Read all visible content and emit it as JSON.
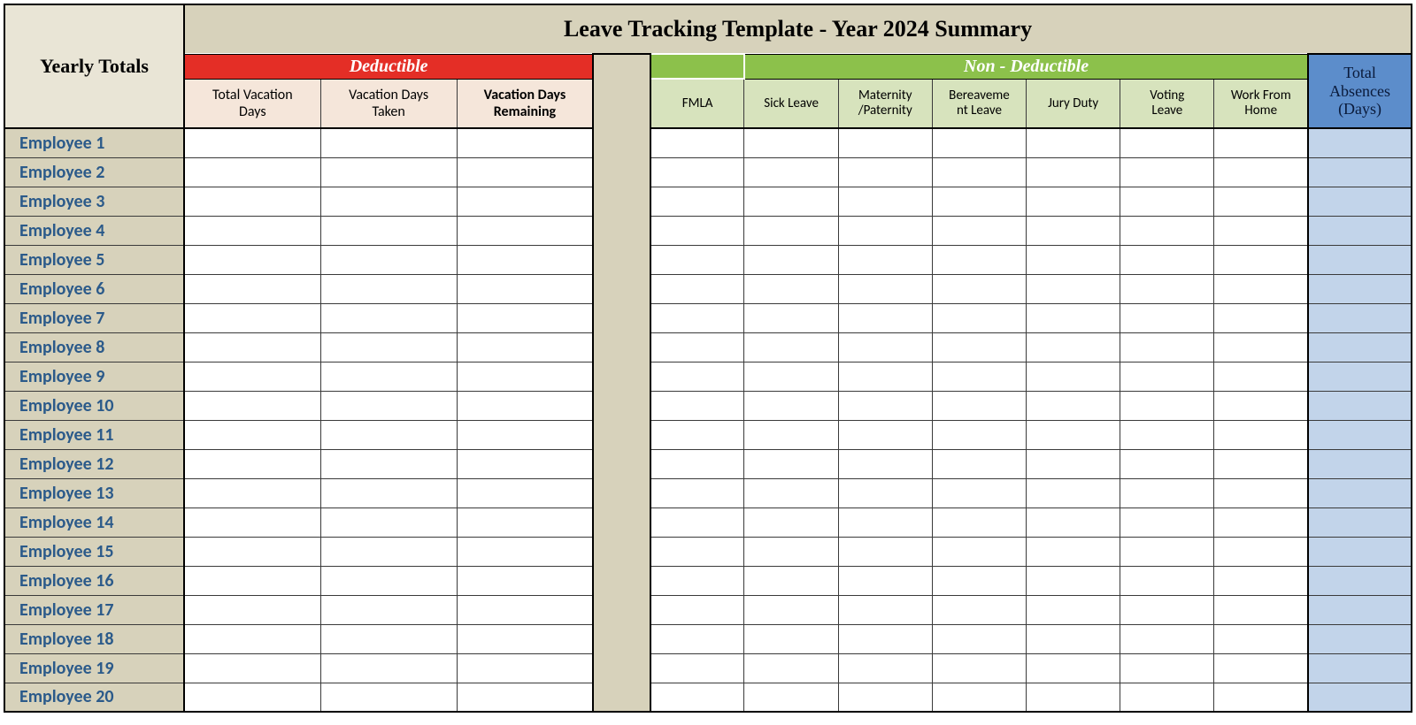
{
  "header": {
    "title": "Leave Tracking Template - Year 2024 Summary",
    "yearly_totals": "Yearly Totals",
    "deductible": "Deductible",
    "non_deductible": "Non - Deductible",
    "total_absences_l1": "Total",
    "total_absences_l2": "Absences",
    "total_absences_l3": "(Days)"
  },
  "ded_cols": {
    "c0_l1": "Total Vacation",
    "c0_l2": "Days",
    "c1_l1": "Vacation Days",
    "c1_l2": "Taken",
    "c2_l1": "Vacation Days",
    "c2_l2": "Remaining"
  },
  "nonded_cols": {
    "c0": "FMLA",
    "c1": "Sick Leave",
    "c2_l1": "Maternity",
    "c2_l2": "/Paternity",
    "c3_l1": "Bereaveme",
    "c3_l2": "nt Leave",
    "c4": "Jury Duty",
    "c5_l1": "Voting",
    "c5_l2": "Leave",
    "c6_l1": "Work From",
    "c6_l2": "Home"
  },
  "employees": [
    {
      "name": "Employee 1",
      "d0": "",
      "d1": "",
      "d2": "",
      "n0": "",
      "n1": "",
      "n2": "",
      "n3": "",
      "n4": "",
      "n5": "",
      "n6": "",
      "total": ""
    },
    {
      "name": "Employee 2",
      "d0": "",
      "d1": "",
      "d2": "",
      "n0": "",
      "n1": "",
      "n2": "",
      "n3": "",
      "n4": "",
      "n5": "",
      "n6": "",
      "total": ""
    },
    {
      "name": "Employee 3",
      "d0": "",
      "d1": "",
      "d2": "",
      "n0": "",
      "n1": "",
      "n2": "",
      "n3": "",
      "n4": "",
      "n5": "",
      "n6": "",
      "total": ""
    },
    {
      "name": "Employee 4",
      "d0": "",
      "d1": "",
      "d2": "",
      "n0": "",
      "n1": "",
      "n2": "",
      "n3": "",
      "n4": "",
      "n5": "",
      "n6": "",
      "total": ""
    },
    {
      "name": "Employee 5",
      "d0": "",
      "d1": "",
      "d2": "",
      "n0": "",
      "n1": "",
      "n2": "",
      "n3": "",
      "n4": "",
      "n5": "",
      "n6": "",
      "total": ""
    },
    {
      "name": "Employee 6",
      "d0": "",
      "d1": "",
      "d2": "",
      "n0": "",
      "n1": "",
      "n2": "",
      "n3": "",
      "n4": "",
      "n5": "",
      "n6": "",
      "total": ""
    },
    {
      "name": "Employee 7",
      "d0": "",
      "d1": "",
      "d2": "",
      "n0": "",
      "n1": "",
      "n2": "",
      "n3": "",
      "n4": "",
      "n5": "",
      "n6": "",
      "total": ""
    },
    {
      "name": "Employee 8",
      "d0": "",
      "d1": "",
      "d2": "",
      "n0": "",
      "n1": "",
      "n2": "",
      "n3": "",
      "n4": "",
      "n5": "",
      "n6": "",
      "total": ""
    },
    {
      "name": "Employee 9",
      "d0": "",
      "d1": "",
      "d2": "",
      "n0": "",
      "n1": "",
      "n2": "",
      "n3": "",
      "n4": "",
      "n5": "",
      "n6": "",
      "total": ""
    },
    {
      "name": "Employee 10",
      "d0": "",
      "d1": "",
      "d2": "",
      "n0": "",
      "n1": "",
      "n2": "",
      "n3": "",
      "n4": "",
      "n5": "",
      "n6": "",
      "total": ""
    },
    {
      "name": "Employee 11",
      "d0": "",
      "d1": "",
      "d2": "",
      "n0": "",
      "n1": "",
      "n2": "",
      "n3": "",
      "n4": "",
      "n5": "",
      "n6": "",
      "total": ""
    },
    {
      "name": "Employee 12",
      "d0": "",
      "d1": "",
      "d2": "",
      "n0": "",
      "n1": "",
      "n2": "",
      "n3": "",
      "n4": "",
      "n5": "",
      "n6": "",
      "total": ""
    },
    {
      "name": "Employee 13",
      "d0": "",
      "d1": "",
      "d2": "",
      "n0": "",
      "n1": "",
      "n2": "",
      "n3": "",
      "n4": "",
      "n5": "",
      "n6": "",
      "total": ""
    },
    {
      "name": "Employee 14",
      "d0": "",
      "d1": "",
      "d2": "",
      "n0": "",
      "n1": "",
      "n2": "",
      "n3": "",
      "n4": "",
      "n5": "",
      "n6": "",
      "total": ""
    },
    {
      "name": "Employee 15",
      "d0": "",
      "d1": "",
      "d2": "",
      "n0": "",
      "n1": "",
      "n2": "",
      "n3": "",
      "n4": "",
      "n5": "",
      "n6": "",
      "total": ""
    },
    {
      "name": "Employee 16",
      "d0": "",
      "d1": "",
      "d2": "",
      "n0": "",
      "n1": "",
      "n2": "",
      "n3": "",
      "n4": "",
      "n5": "",
      "n6": "",
      "total": ""
    },
    {
      "name": "Employee 17",
      "d0": "",
      "d1": "",
      "d2": "",
      "n0": "",
      "n1": "",
      "n2": "",
      "n3": "",
      "n4": "",
      "n5": "",
      "n6": "",
      "total": ""
    },
    {
      "name": "Employee 18",
      "d0": "",
      "d1": "",
      "d2": "",
      "n0": "",
      "n1": "",
      "n2": "",
      "n3": "",
      "n4": "",
      "n5": "",
      "n6": "",
      "total": ""
    },
    {
      "name": "Employee 19",
      "d0": "",
      "d1": "",
      "d2": "",
      "n0": "",
      "n1": "",
      "n2": "",
      "n3": "",
      "n4": "",
      "n5": "",
      "n6": "",
      "total": ""
    },
    {
      "name": "Employee 20",
      "d0": "",
      "d1": "",
      "d2": "",
      "n0": "",
      "n1": "",
      "n2": "",
      "n3": "",
      "n4": "",
      "n5": "",
      "n6": "",
      "total": ""
    }
  ]
}
